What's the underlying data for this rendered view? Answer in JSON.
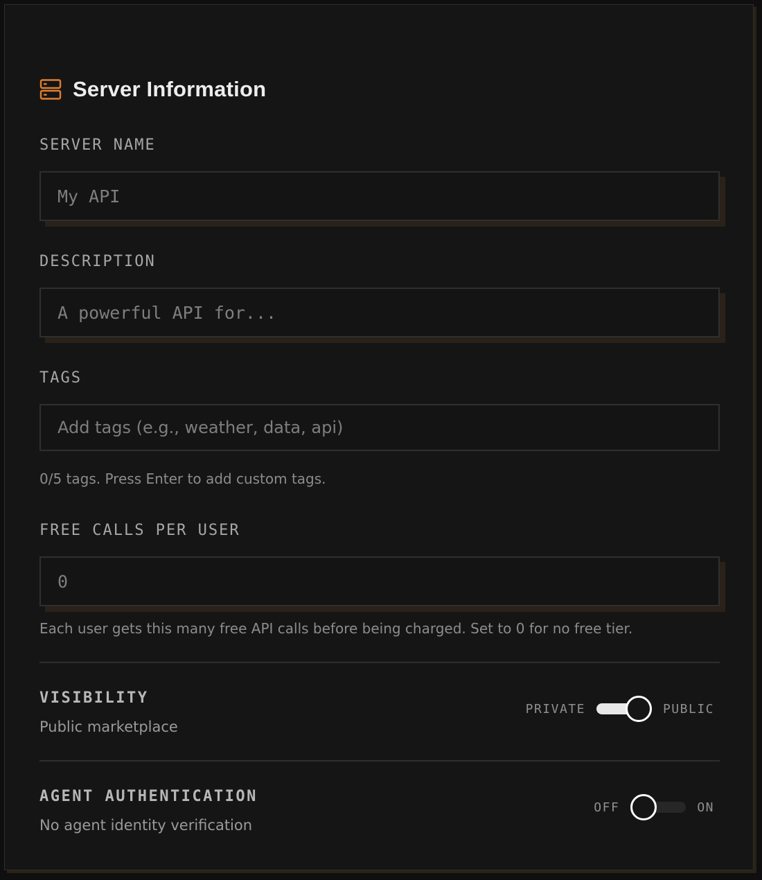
{
  "section": {
    "title": "Server Information",
    "icon": "server-icon",
    "accent_color": "#e07f2e"
  },
  "server_name": {
    "label": "SERVER NAME",
    "value": "",
    "placeholder": "My API"
  },
  "description": {
    "label": "DESCRIPTION",
    "value": "",
    "placeholder": "A powerful API for..."
  },
  "tags": {
    "label": "TAGS",
    "value": "",
    "placeholder": "Add tags (e.g., weather, data, api)",
    "help": "0/5 tags. Press Enter to add custom tags."
  },
  "free_calls": {
    "label": "FREE CALLS PER USER",
    "value": "",
    "placeholder": "0",
    "help": "Each user gets this many free API calls before being charged. Set to 0 for no free tier."
  },
  "visibility": {
    "title": "VISIBILITY",
    "subtitle": "Public marketplace",
    "off_label": "PRIVATE",
    "on_label": "PUBLIC",
    "state": "on"
  },
  "agent_auth": {
    "title": "AGENT AUTHENTICATION",
    "subtitle": "No agent identity verification",
    "off_label": "OFF",
    "on_label": "ON",
    "state": "off"
  }
}
